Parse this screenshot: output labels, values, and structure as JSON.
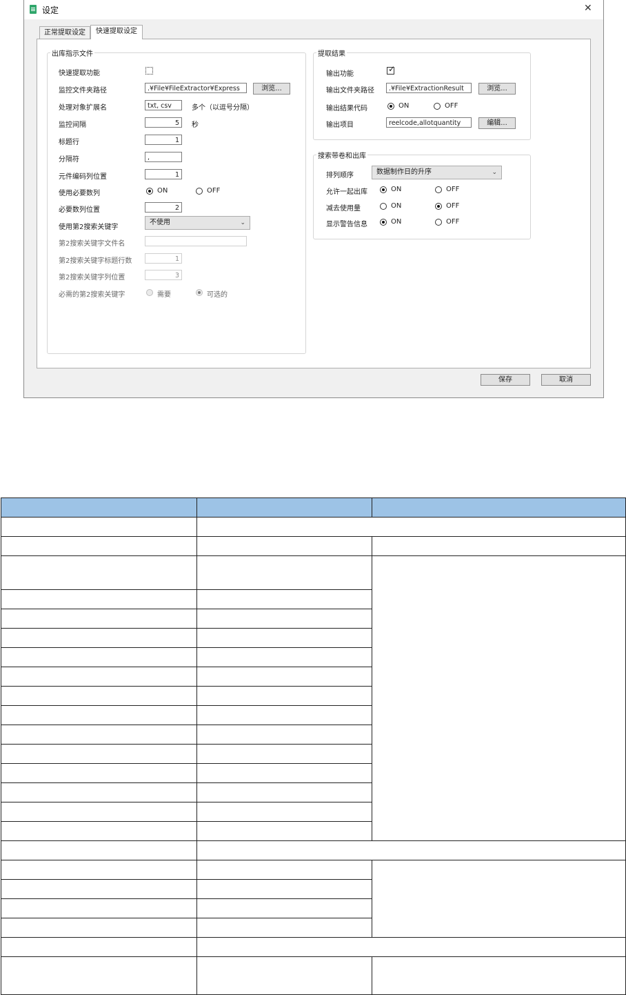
{
  "dialog": {
    "title": "设定",
    "tabs": [
      "正常提取设定",
      "快速提取设定"
    ],
    "left_group": {
      "title": "出库指示文件",
      "quick_extract_label": "快速提取功能",
      "monitor_folder_label": "监控文件夹路径",
      "monitor_folder_value": ".¥File¥FileExtractor¥Express",
      "browse_label": "浏览...",
      "target_ext_label": "处理对象扩展名",
      "target_ext_value": "txt, csv",
      "target_ext_hint": "多个（以逗号分隔）",
      "interval_label": "监控间隔",
      "interval_value": "5",
      "interval_unit": "秒",
      "header_row_label": "标题行",
      "header_row_value": "1",
      "delimiter_label": "分隔符",
      "delimiter_value": ",",
      "code_col_label": "元件编码列位置",
      "code_col_value": "1",
      "use_qty_col_label": "使用必要数列",
      "on_label": "ON",
      "off_label": "OFF",
      "qty_col_label": "必要数列位置",
      "qty_col_value": "2",
      "use_key2_label": "使用第2搜索关键字",
      "use_key2_value": "不使用",
      "key2_file_label": "第2搜索关键字文件名",
      "key2_file_value": "",
      "key2_header_label": "第2搜索关键字标题行数",
      "key2_header_value": "1",
      "key2_col_label": "第2搜索关键字列位置",
      "key2_col_value": "3",
      "key2_required_label": "必需的第2搜索关键字",
      "required_label": "需要",
      "optional_label": "可选的"
    },
    "result_group": {
      "title": "提取结果",
      "output_label": "输出功能",
      "output_folder_label": "输出文件夹路径",
      "output_folder_value": ".¥File¥ExtractionResult",
      "browse_label": "浏览...",
      "result_code_label": "输出结果代码",
      "on_label": "ON",
      "off_label": "OFF",
      "items_label": "输出项目",
      "items_value": "reelcode,allotquantity",
      "edit_label": "编辑..."
    },
    "search_group": {
      "title": "搜索带卷和出库",
      "sort_label": "排列顺序",
      "sort_value": "数据制作日的升序",
      "allow_label": "允许一起出库",
      "subtract_label": "减去使用量",
      "warn_label": "显示警告信息",
      "on_label": "ON",
      "off_label": "OFF"
    },
    "save_label": "保存",
    "cancel_label": "取消"
  },
  "table": {
    "columns": 3,
    "rows": 24
  }
}
